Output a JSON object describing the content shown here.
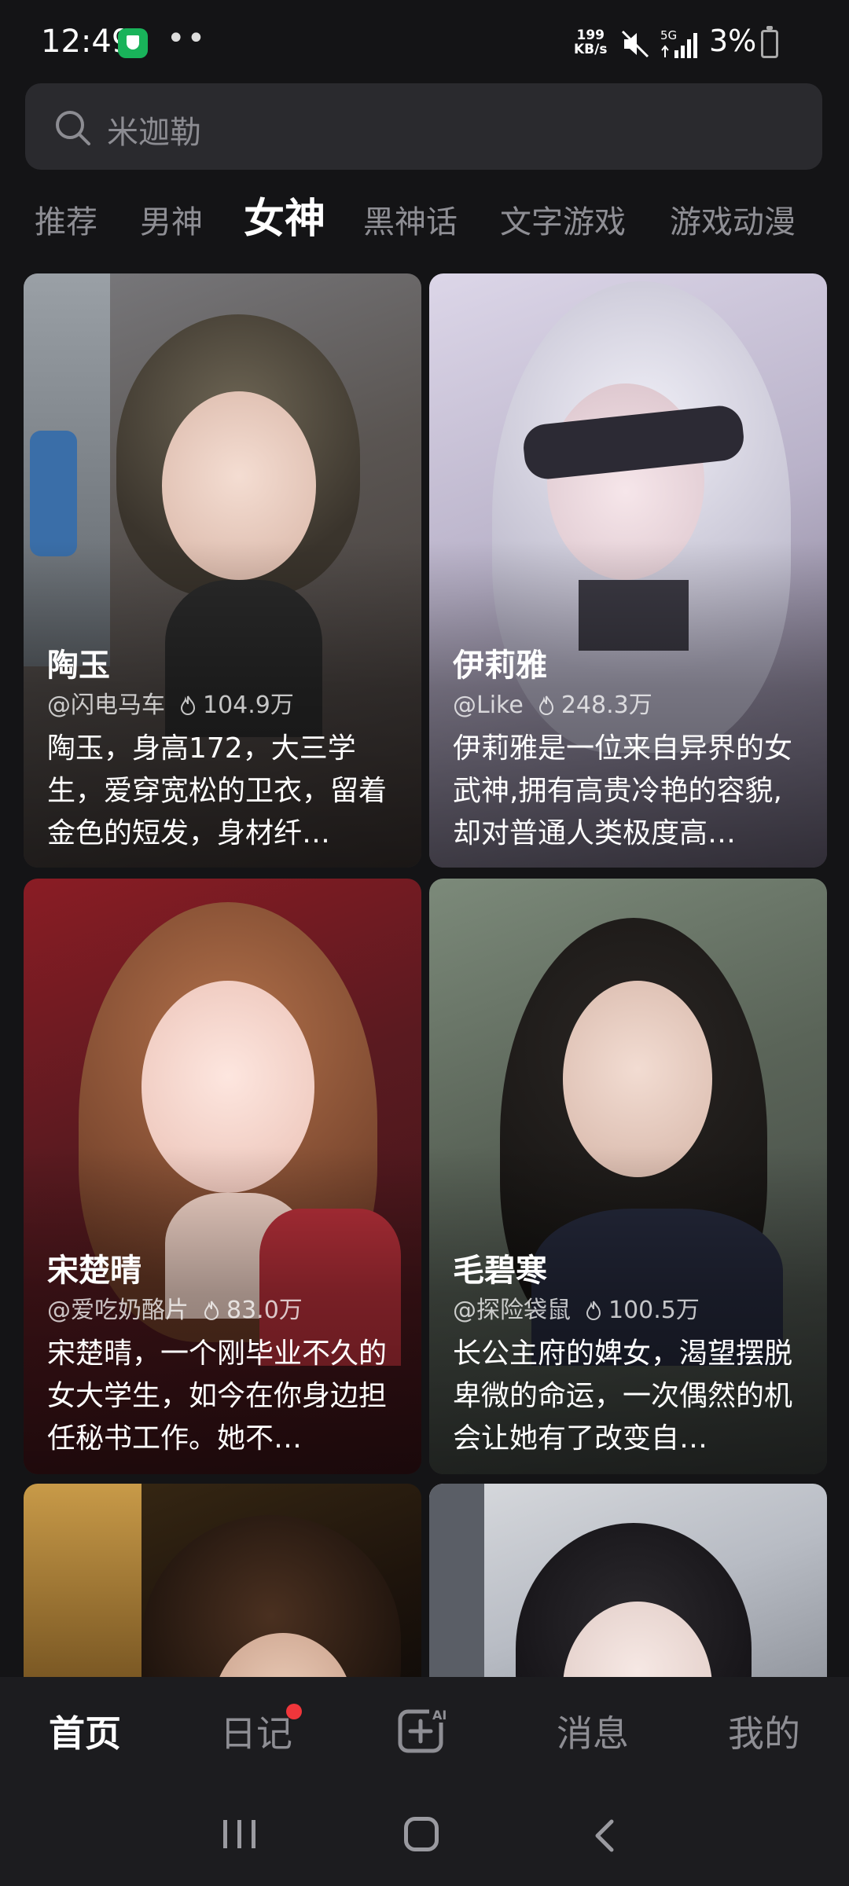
{
  "status_bar": {
    "time": "12:49",
    "net_speed_value": "199",
    "net_speed_unit": "KB/s",
    "network": "5G",
    "battery": "3%"
  },
  "search": {
    "placeholder": "米迦勒"
  },
  "tabs": [
    {
      "label": "推荐"
    },
    {
      "label": "男神"
    },
    {
      "label": "女神",
      "active": true
    },
    {
      "label": "黑神话"
    },
    {
      "label": "文字游戏"
    },
    {
      "label": "游戏动漫"
    }
  ],
  "cards": [
    {
      "name": "陶玉",
      "author": "@闪电马车",
      "heat": "104.9万",
      "desc": "陶玉，身高172，大三学生，爱穿宽松的卫衣，留着金色的短发，身材纤…"
    },
    {
      "name": "伊莉雅",
      "author": "@Like",
      "heat": "248.3万",
      "desc": "伊莉雅是一位来自异界的女武神,拥有高贵冷艳的容貌,却对普通人类极度高…"
    },
    {
      "name": "宋楚晴",
      "author": "@爱吃奶酪片",
      "heat": "83.0万",
      "desc": "宋楚晴，一个刚毕业不久的女大学生，如今在你身边担任秘书工作。她不…"
    },
    {
      "name": "毛碧寒",
      "author": "@探险袋鼠",
      "heat": "100.5万",
      "desc": "长公主府的婢女，渴望摆脱卑微的命运，一次偶然的机会让她有了改变自…"
    }
  ],
  "bottom_nav": [
    {
      "label": "首页",
      "active": true
    },
    {
      "label": "日记",
      "badge": true
    },
    {
      "label": "AI create",
      "icon": "ai-create-icon"
    },
    {
      "label": "消息"
    },
    {
      "label": "我的"
    }
  ],
  "colors": {
    "background": "#141416",
    "search_bg": "#2a2a2e",
    "inactive_text": "#8e8e94",
    "badge": "#f0363b"
  }
}
